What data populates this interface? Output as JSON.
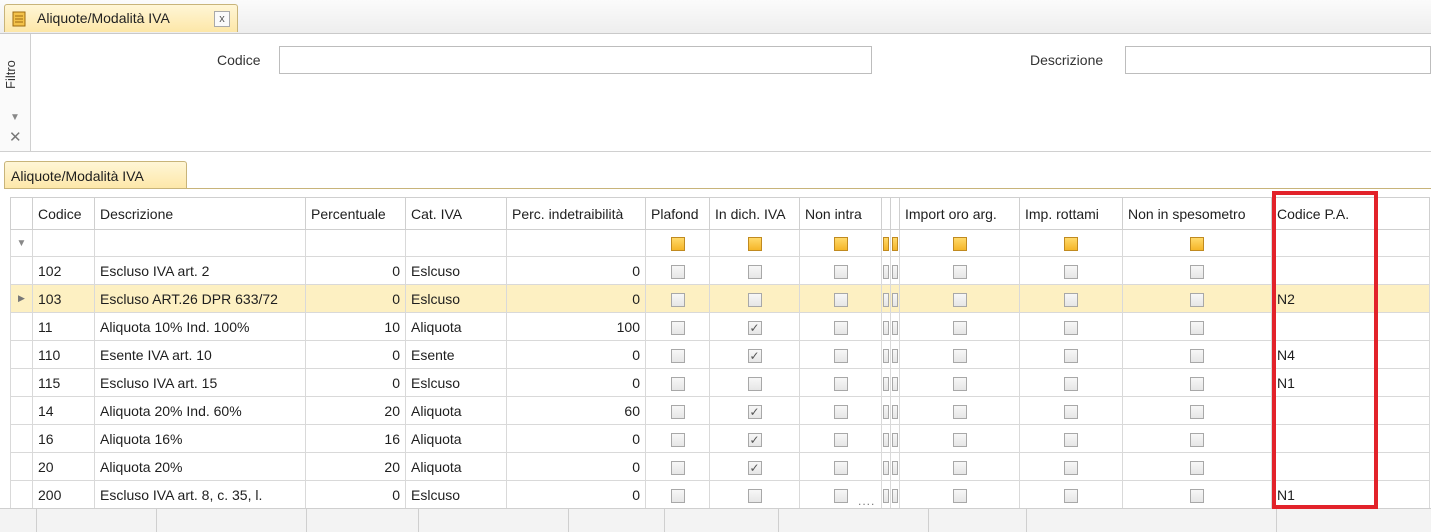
{
  "document_tab": {
    "label": "Aliquote/Modalità IVA",
    "close": "x",
    "icon": "ledger-icon"
  },
  "filter": {
    "side_label": "Filtro",
    "codice_label": "Codice",
    "codice_value": "",
    "descrizione_label": "Descrizione",
    "descrizione_value": ""
  },
  "grid_tab": {
    "label": "Aliquote/Modalità IVA"
  },
  "columns": {
    "codice": "Codice",
    "descrizione": "Descrizione",
    "percentuale": "Percentuale",
    "cat_iva": "Cat. IVA",
    "perc_indetraibilita": "Perc. indetraibilità",
    "plafond": "Plafond",
    "in_dich_iva": "In dich. IVA",
    "non_intra": "Non intra",
    "import_oro_arg": "Import oro arg.",
    "imp_rottami": "Imp. rottami",
    "non_in_spesometro": "Non in spesometro",
    "codice_pa": "Codice P.A."
  },
  "rows": [
    {
      "codice": "102",
      "descrizione": "Escluso IVA art. 2",
      "percentuale": "0",
      "cat_iva": "Eslcuso",
      "perc_indetraibilita": "0",
      "in_dich_iva": false,
      "codice_pa": ""
    },
    {
      "codice": "103",
      "descrizione": "Escluso ART.26 DPR 633/72",
      "percentuale": "0",
      "cat_iva": "Eslcuso",
      "perc_indetraibilita": "0",
      "in_dich_iva": false,
      "codice_pa": "N2",
      "selected": true
    },
    {
      "codice": "11",
      "descrizione": "Aliquota 10% Ind. 100%",
      "percentuale": "10",
      "cat_iva": "Aliquota",
      "perc_indetraibilita": "100",
      "in_dich_iva": true,
      "codice_pa": ""
    },
    {
      "codice": "110",
      "descrizione": "Esente IVA art. 10",
      "percentuale": "0",
      "cat_iva": "Esente",
      "perc_indetraibilita": "0",
      "in_dich_iva": true,
      "codice_pa": "N4"
    },
    {
      "codice": "115",
      "descrizione": "Escluso IVA art. 15",
      "percentuale": "0",
      "cat_iva": "Eslcuso",
      "perc_indetraibilita": "0",
      "in_dich_iva": false,
      "codice_pa": "N1"
    },
    {
      "codice": "14",
      "descrizione": "Aliquota 20% Ind. 60%",
      "percentuale": "20",
      "cat_iva": "Aliquota",
      "perc_indetraibilita": "60",
      "in_dich_iva": true,
      "codice_pa": ""
    },
    {
      "codice": "16",
      "descrizione": "Aliquota 16%",
      "percentuale": "16",
      "cat_iva": "Aliquota",
      "perc_indetraibilita": "0",
      "in_dich_iva": true,
      "codice_pa": ""
    },
    {
      "codice": "20",
      "descrizione": "Aliquota 20%",
      "percentuale": "20",
      "cat_iva": "Aliquota",
      "perc_indetraibilita": "0",
      "in_dich_iva": true,
      "codice_pa": ""
    },
    {
      "codice": "200",
      "descrizione": "Escluso IVA art. 8, c. 35, l.",
      "percentuale": "0",
      "cat_iva": "Eslcuso",
      "perc_indetraibilita": "0",
      "in_dich_iva": false,
      "codice_pa": "N1"
    }
  ],
  "colors": {
    "highlight": "#e2222a",
    "selected_row": "#fdf0c2",
    "tab_fill": "#fde7a8"
  }
}
